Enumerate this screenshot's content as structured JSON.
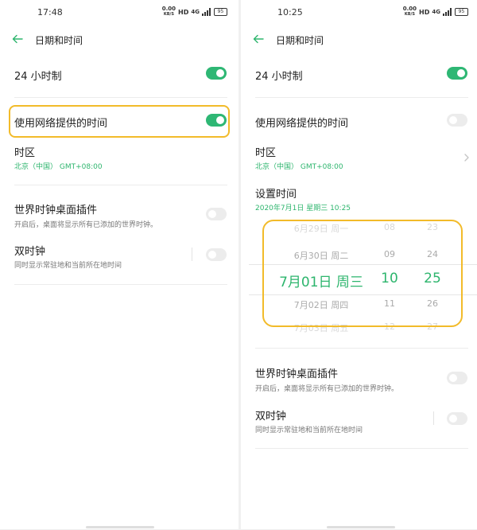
{
  "left": {
    "status": {
      "time": "17:48",
      "data_top": "0.00",
      "data_bottom": "KB/S",
      "hd": "HD",
      "net": "4G",
      "battery": "95"
    },
    "header": {
      "title": "日期和时间"
    },
    "rows": {
      "h24": {
        "title": "24 小时制",
        "toggle": "on"
      },
      "network_time": {
        "title": "使用网络提供的时间",
        "toggle": "on",
        "highlighted": true
      },
      "timezone": {
        "title": "时区",
        "value": "北京（中国）  GMT+08:00"
      },
      "world_clock": {
        "title": "世界时钟桌面插件",
        "sub": "开启后，桌面将显示所有已添加的世界时钟。",
        "toggle": "off"
      },
      "dual_clock": {
        "title": "双时钟",
        "sub": "同时显示常驻地和当前所在地时间",
        "toggle": "off"
      }
    }
  },
  "right": {
    "status": {
      "time": "10:25",
      "data_top": "0.00",
      "data_bottom": "KB/S",
      "hd": "HD",
      "net": "4G",
      "battery": "95"
    },
    "header": {
      "title": "日期和时间"
    },
    "rows": {
      "h24": {
        "title": "24 小时制",
        "toggle": "on"
      },
      "network_time": {
        "title": "使用网络提供的时间",
        "toggle": "off"
      },
      "timezone": {
        "title": "时区",
        "value": "北京（中国）  GMT+08:00"
      },
      "set_time": {
        "title": "设置时间",
        "value": "2020年7月1日 星期三  10:25"
      },
      "world_clock": {
        "title": "世界时钟桌面插件",
        "sub": "开启后，桌面将显示所有已添加的世界时钟。",
        "toggle": "off"
      },
      "dual_clock": {
        "title": "双时钟",
        "sub": "同时显示常驻地和当前所在地时间",
        "toggle": "off"
      }
    },
    "picker": {
      "dates": [
        "6月29日 周一",
        "6月30日 周二",
        "7月01日 周三",
        "7月02日 周四",
        "7月03日 周五"
      ],
      "hours": [
        "08",
        "09",
        "10",
        "11",
        "12"
      ],
      "minutes": [
        "23",
        "24",
        "25",
        "26",
        "27"
      ]
    }
  },
  "colors": {
    "accent": "#2db56d",
    "toggle_on": "#2eb774",
    "highlight": "#f2bb2a"
  }
}
